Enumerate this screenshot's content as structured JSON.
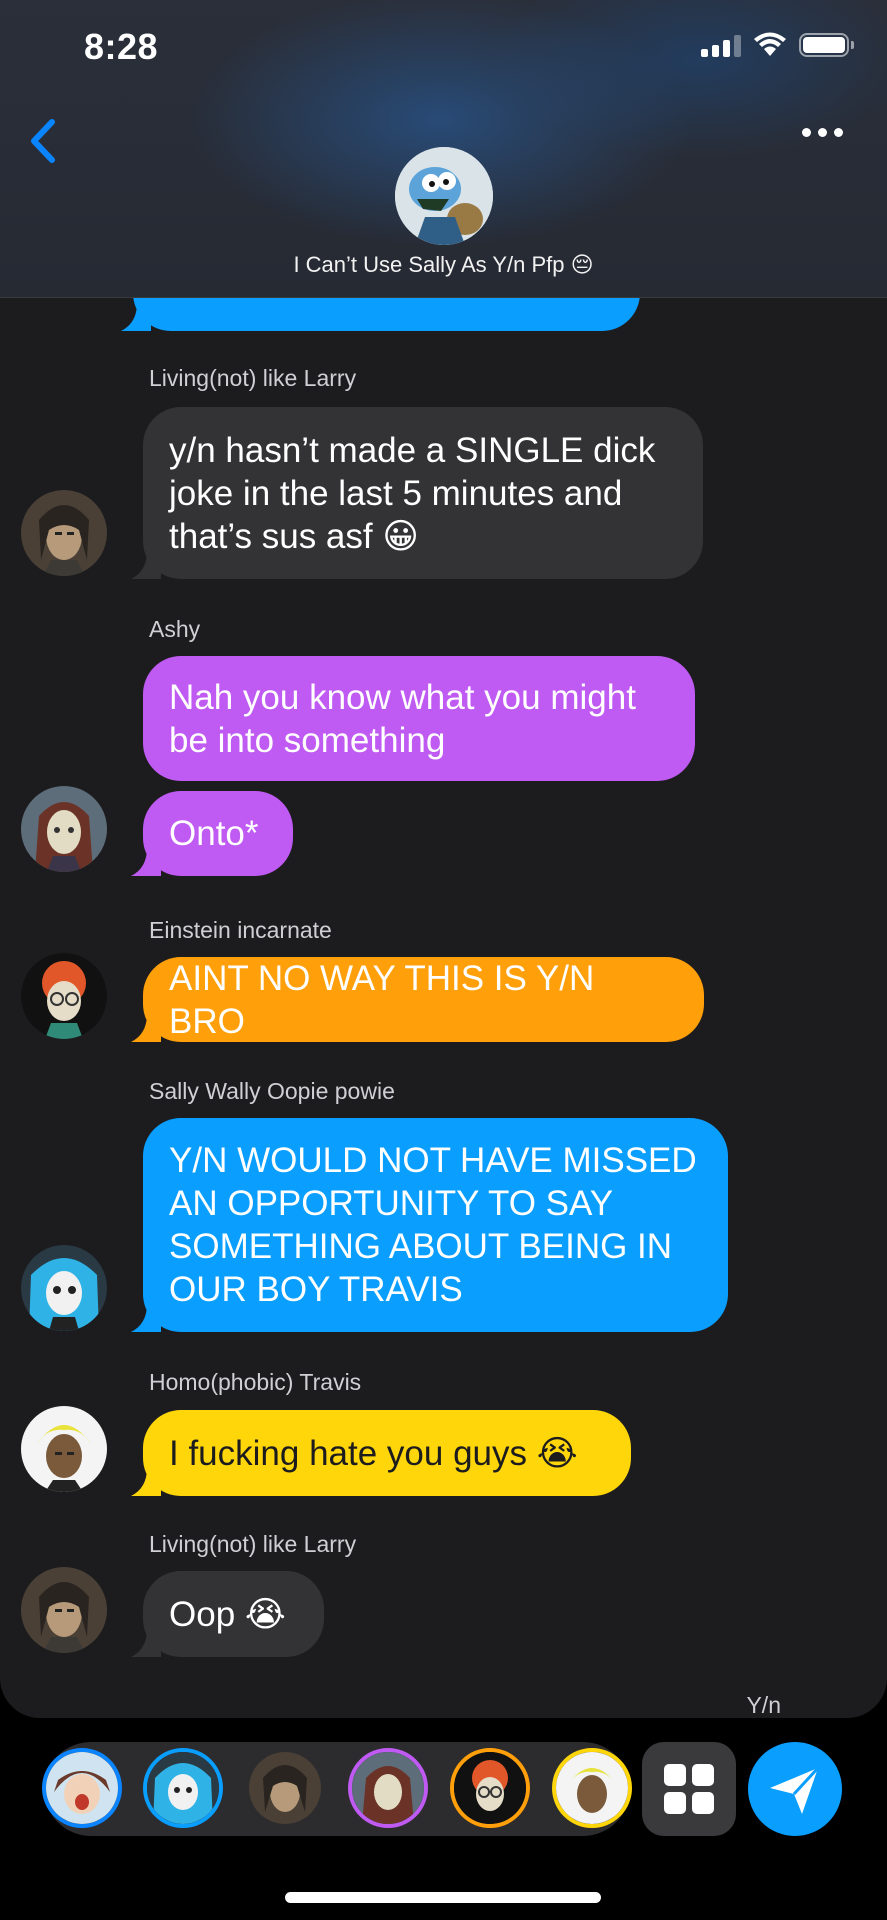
{
  "status_bar": {
    "time": "8:28"
  },
  "header": {
    "group_name": "I Can’t Use Sally As Y/n Pfp 😔"
  },
  "messages": [
    {
      "sender": "Living(not) like Larry",
      "lines": [
        "y/n hasn’t made a SINGLE dick",
        "joke in the last 5 minutes and",
        "that’s sus asf 😀"
      ],
      "color": "#333335"
    },
    {
      "sender": "Ashy",
      "lines": [
        "Nah you know what you might",
        "be into something"
      ],
      "color": "#bf5af2"
    },
    {
      "sender": "",
      "lines": [
        "Onto*"
      ],
      "color": "#bf5af2"
    },
    {
      "sender": "Einstein incarnate",
      "lines": [
        "AINT NO WAY THIS IS Y/N BRO"
      ],
      "color": "#ff9f0a"
    },
    {
      "sender": "Sally Wally Oopie powie",
      "lines": [
        "Y/N WOULD NOT HAVE MISSED",
        "AN OPPORTUNITY TO SAY",
        "SOMETHING ABOUT BEING IN",
        "OUR BOY TRAVIS"
      ],
      "color": "#0a9eff"
    },
    {
      "sender": "Homo(phobic) Travis",
      "lines": [
        "I fucking hate you guys 😭"
      ],
      "color": "#ffd60a"
    },
    {
      "sender": "Living(not) like Larry",
      "lines": [
        "Oop 😭"
      ],
      "color": "#333335"
    }
  ],
  "my_name_label": "Y/n",
  "icons": {
    "back": "chevron-left-icon",
    "more": "ellipsis-icon",
    "grid": "grid-icon",
    "send": "paper-plane-icon"
  }
}
